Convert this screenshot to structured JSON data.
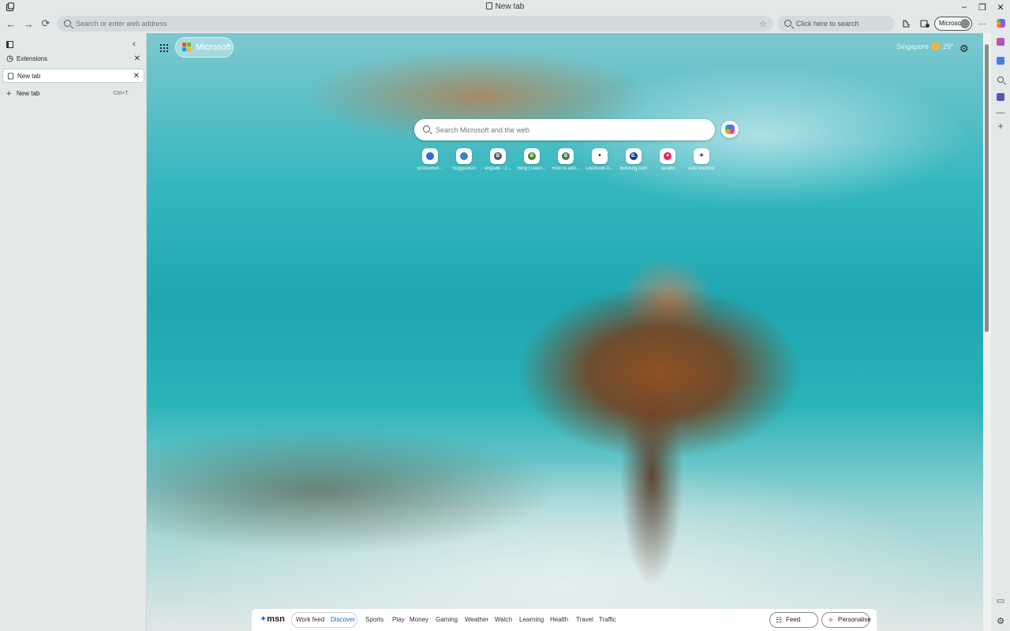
{
  "window": {
    "title": "New tab",
    "controls": {
      "minimize": "–",
      "restore": "❐",
      "close": "✕"
    }
  },
  "nav": {
    "back": "←",
    "forward": "→",
    "refresh": "⟳",
    "address_placeholder": "Search or enter web address",
    "favorite_star": "☆",
    "search_placeholder": "Click here to search",
    "profile_label": "Microsoft",
    "more": "···"
  },
  "sidebar": {
    "collapse": "‹",
    "tabs": [
      {
        "label": "Extensions",
        "close": "✕"
      },
      {
        "label": "New tab",
        "close": "✕"
      }
    ],
    "new_tab": {
      "label": "New tab",
      "shortcut": "Ctrl+T",
      "plus": "+"
    }
  },
  "newtab": {
    "brand": "Microsoft",
    "weather_location": "Singapore",
    "weather_temp": "29°",
    "settings": "⚙",
    "search_placeholder": "Search Microsoft and the web",
    "shortcuts": [
      {
        "label": "productivit...",
        "color": "#2d6cdf",
        "glyph": ""
      },
      {
        "label": "Suggestion",
        "color": "#3b82c4",
        "glyph": ""
      },
      {
        "label": "engwiki - z...",
        "color": "#4a5d6e",
        "glyph": "B"
      },
      {
        "label": "Bing | Dash...",
        "color": "#3a8f2a",
        "glyph": "B"
      },
      {
        "label": "How to add...",
        "color": "#3f7a5c",
        "glyph": "B"
      },
      {
        "label": "Loomodo A...",
        "color": "#ffffff",
        "glyph": "•"
      },
      {
        "label": "Booking.com",
        "color": "#0b3b8c",
        "glyph": "B."
      },
      {
        "label": "Tacado",
        "color": "#e0285a",
        "glyph": "♥"
      },
      {
        "label": "Add shortcut",
        "color": "#ffffff",
        "glyph": "+"
      }
    ]
  },
  "feed": {
    "logo": "msn",
    "nav": [
      "Work feed",
      "Discover",
      "Sports",
      "Play",
      "Money",
      "Gaming",
      "Weather",
      "Watch",
      "Learning",
      "Health",
      "Travel",
      "Traffic"
    ],
    "active": "Discover",
    "feed_layout": "Feed layout",
    "personalise": "Personalise"
  },
  "colors": {
    "chrome_bg": "#e3e9e9",
    "accent": "#1a5fcf",
    "microsoft_logo": [
      "#f25022",
      "#7fba00",
      "#00a4ef",
      "#ffb900"
    ]
  }
}
